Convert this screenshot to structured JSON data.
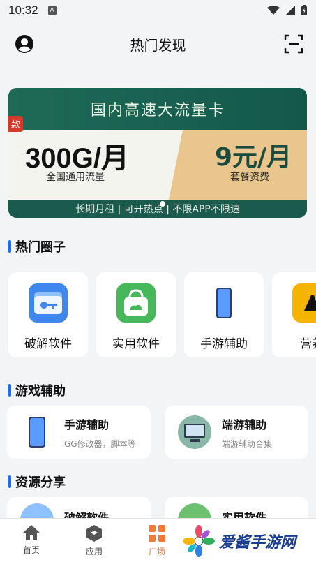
{
  "status": {
    "time": "10:32",
    "a_glyph": "A"
  },
  "header": {
    "title": "热门发现",
    "left_icon": "user-circle-icon",
    "right_icon": "scan-icon"
  },
  "banner": {
    "top_text": "国内高速大流量卡",
    "tag": "款",
    "big_text": "300G/月",
    "sub_left": "全国通用流量",
    "price": "9元/月",
    "sub_right": "套餐资费",
    "bottom_text": "长期月租 | 可开热点 | 不限APP不限速"
  },
  "sections": {
    "hot_circles": "热门圈子",
    "game_aux": "游戏辅助",
    "resources": "资源分享"
  },
  "circles": [
    {
      "label": "破解软件",
      "icon": "folder-key-icon"
    },
    {
      "label": "实用软件",
      "icon": "shopping-bag-icon"
    },
    {
      "label": "手游辅助",
      "icon": "phone-icon"
    },
    {
      "label": "营养",
      "icon": "yellow-app-icon"
    }
  ],
  "game_aux": [
    {
      "title": "手游辅助",
      "desc": "GG修改器，脚本等",
      "icon": "phone-icon"
    },
    {
      "title": "端游辅助",
      "desc": "端游辅助合集",
      "icon": "monitor-icon"
    }
  ],
  "resources": [
    {
      "title": "破解软件",
      "icon": "folder-key-icon"
    },
    {
      "title": "实用软件",
      "icon": "shopping-bag-icon"
    }
  ],
  "tabs": [
    {
      "label": "首页",
      "icon": "home-icon",
      "active": false
    },
    {
      "label": "应用",
      "icon": "cube-icon",
      "active": false
    },
    {
      "label": "广场",
      "icon": "grid-icon",
      "active": true
    }
  ],
  "watermark": {
    "text": "爱酱手游网"
  },
  "colors": {
    "accent": "#f07a3a",
    "section_bar": "#1a6bff",
    "banner_green": "#1d5a4c"
  }
}
